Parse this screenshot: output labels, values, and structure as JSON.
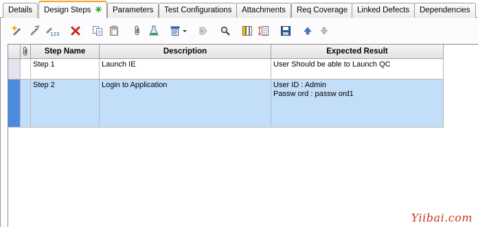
{
  "tabs": [
    {
      "label": "Details",
      "active": false
    },
    {
      "label": "Design Steps",
      "active": true,
      "modified_marker": "✳"
    },
    {
      "label": "Parameters",
      "active": false
    },
    {
      "label": "Test Configurations",
      "active": false
    },
    {
      "label": "Attachments",
      "active": false
    },
    {
      "label": "Req Coverage",
      "active": false
    },
    {
      "label": "Linked Defects",
      "active": false
    },
    {
      "label": "Dependencies",
      "active": false
    }
  ],
  "toolbar": {
    "icons": [
      "new-step-icon",
      "edit-step-icon",
      "renumber-steps-icon",
      "delete-icon",
      "copy-icon",
      "paste-icon",
      "attachment-icon",
      "generate-script-icon",
      "call-to-test-icon",
      "insert-parameter-icon",
      "find-icon",
      "select-columns-icon",
      "adjust-columns-icon",
      "save-icon",
      "move-up-icon",
      "move-down-icon"
    ]
  },
  "grid": {
    "columns": {
      "attachment": "",
      "step_name": "Step Name",
      "description": "Description",
      "expected_result": "Expected Result"
    },
    "rows": [
      {
        "step_name": "Step 1",
        "description": "Launch IE",
        "expected_result": "User Should be able to Launch QC",
        "selected": false
      },
      {
        "step_name": "Step 2",
        "description": "Login to Application",
        "expected_result": "User ID : Admin\nPassw ord : passw ord1",
        "selected": true
      }
    ]
  },
  "watermark": "Yiibai.com",
  "colors": {
    "selected_row": "#c3def9",
    "active_tab_accent": "#f2a31f",
    "delete_red": "#cc2222"
  }
}
